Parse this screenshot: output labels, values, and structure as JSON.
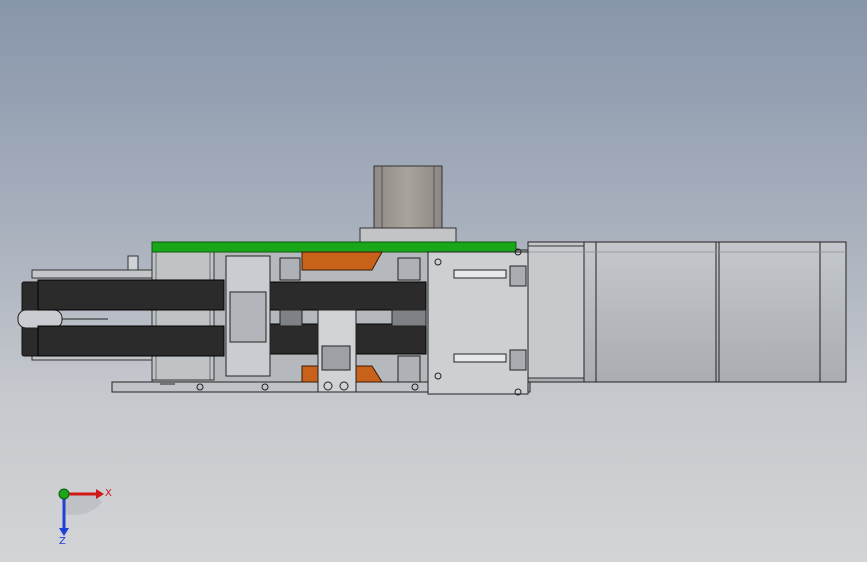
{
  "view": {
    "background_top": "#8795aa",
    "background_bottom": "#d3d4d6"
  },
  "triad": {
    "x_label": "X",
    "z_label": "Z",
    "x_color": "#d01818",
    "y_color": "#1aa51a",
    "z_color": "#1f3fd6"
  },
  "colors": {
    "green_board": "#19a619",
    "copper": "#c8621a",
    "belt": "#2b2b2b",
    "steel": "#b9bcc0",
    "motor": "#9c9893"
  }
}
